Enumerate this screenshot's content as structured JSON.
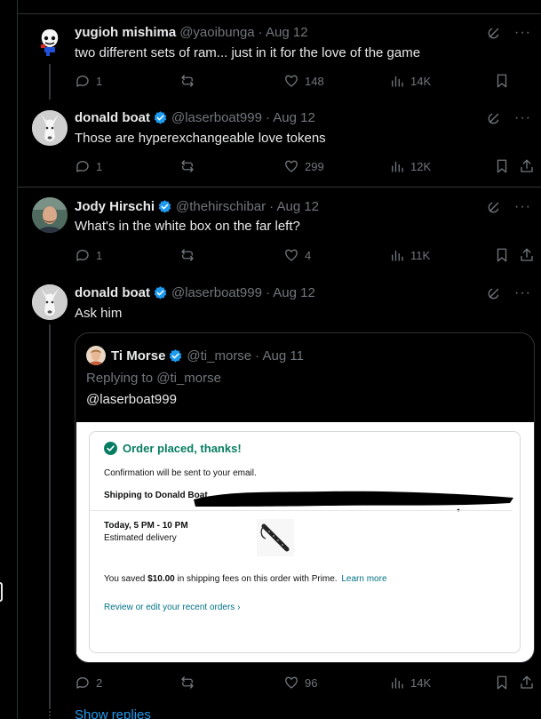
{
  "posts": [
    {
      "name": "yugioh mishima",
      "handle": "@yaoibunga",
      "date": "· Aug 12",
      "text": "two different sets of ram... just in it for the love of the game",
      "replies": "1",
      "likes": "148",
      "views": "14K",
      "verified": false
    },
    {
      "name": "donald boat",
      "handle": "@laserboat999",
      "date": "· Aug 12",
      "text": "Those are hyperexchangeable love tokens",
      "replies": "1",
      "likes": "299",
      "views": "12K",
      "verified": true
    },
    {
      "name": "Jody Hirschi",
      "handle": "@thehirschibar",
      "date": "· Aug 12",
      "text": "What's in the white box on the far left?",
      "replies": "1",
      "likes": "4",
      "views": "11K",
      "verified": true
    },
    {
      "name": "donald boat",
      "handle": "@laserboat999",
      "date": "· Aug 12",
      "text": "Ask him",
      "replies": "2",
      "likes": "96",
      "views": "14K",
      "verified": true
    }
  ],
  "quote": {
    "name": "Ti Morse",
    "handle": "@ti_morse",
    "date": "· Aug 11",
    "replying_to": "Replying to @ti_morse",
    "text": "@laserboat999",
    "order": {
      "title": "Order placed, thanks!",
      "confirmation": "Confirmation will be sent to your email.",
      "shipping": "Shipping to Donald Boat,",
      "delivery_time": "Today, 5 PM - 10 PM",
      "delivery_label": "Estimated delivery",
      "saved_prefix": "You saved ",
      "saved_amount": "$10.00",
      "saved_suffix": " in shipping fees on this order with Prime.",
      "learn_more": "Learn more",
      "review_link": "Review or edit your recent orders ›"
    }
  },
  "show_replies": "Show replies",
  "colors": {
    "background": "#000000",
    "text": "#e7e9ea",
    "muted": "#71767b",
    "accent_blue": "#1d9bf0",
    "amazon_green": "#067d62",
    "amazon_link": "#007185"
  }
}
